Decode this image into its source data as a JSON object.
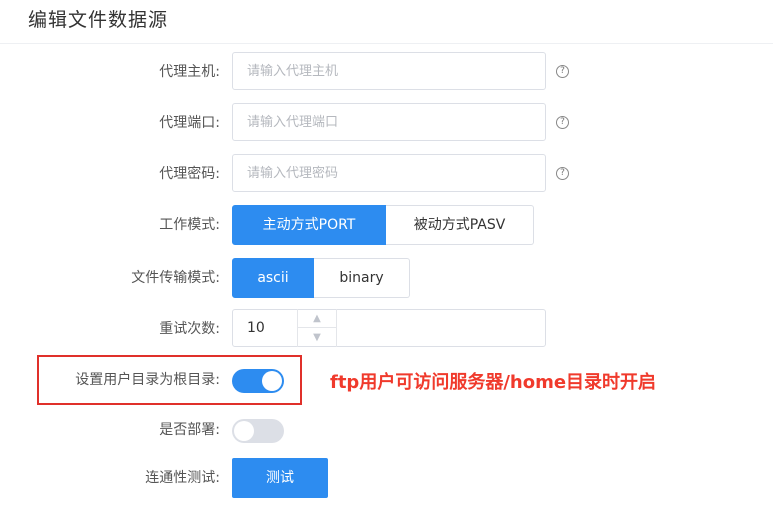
{
  "page": {
    "title": "编辑文件数据源"
  },
  "form": {
    "proxy_host": {
      "label": "代理主机:",
      "placeholder": "请输入代理主机",
      "value": ""
    },
    "proxy_port": {
      "label": "代理端口:",
      "placeholder": "请输入代理端口",
      "value": ""
    },
    "proxy_password": {
      "label": "代理密码:",
      "placeholder": "请输入代理密码",
      "value": ""
    },
    "work_mode": {
      "label": "工作模式:",
      "options": [
        "主动方式PORT",
        "被动方式PASV"
      ],
      "selected": "主动方式PORT"
    },
    "transfer_mode": {
      "label": "文件传输模式:",
      "options": [
        "ascii",
        "binary"
      ],
      "selected": "ascii"
    },
    "retry_count": {
      "label": "重试次数:",
      "value": "10"
    },
    "home_as_root": {
      "label": "设置用户目录为根目录:",
      "enabled": true
    },
    "deploy": {
      "label": "是否部署:",
      "enabled": false
    },
    "connectivity_test": {
      "label": "连通性测试:",
      "button_label": "测试"
    }
  },
  "annotation": {
    "text": "ftp用户可访问服务器/home目录时开启",
    "color": "#f03a2c"
  },
  "colors": {
    "accent": "#2d8cf0",
    "highlight_border": "#e0302a"
  },
  "icons": {
    "help": "question-circle-icon",
    "spin_up": "chevron-up-icon",
    "spin_down": "chevron-down-icon"
  }
}
